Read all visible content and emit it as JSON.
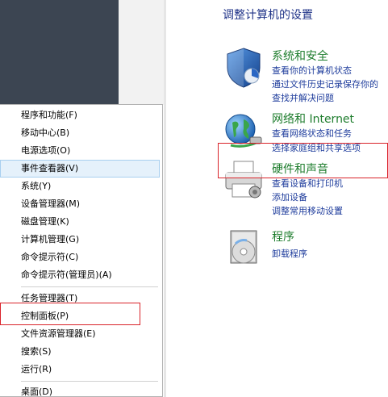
{
  "control_panel": {
    "title": "调整计算机的设置",
    "categories": [
      {
        "icon": "shield-icon",
        "heading": "系统和安全",
        "links": [
          "查看你的计算机状态",
          "通过文件历史记录保存你的",
          "查找并解决问题"
        ]
      },
      {
        "icon": "network-globe-icon",
        "heading": "网络和 Internet",
        "links": [
          "查看网络状态和任务",
          "选择家庭组和共享选项"
        ]
      },
      {
        "icon": "printer-icon",
        "heading": "硬件和声音",
        "links": [
          "查看设备和打印机",
          "添加设备",
          "调整常用移动设置"
        ]
      },
      {
        "icon": "programs-disc-icon",
        "heading": "程序",
        "links": [
          "卸载程序"
        ]
      }
    ]
  },
  "context_menu": {
    "items": [
      "程序和功能(F)",
      "移动中心(B)",
      "电源选项(O)",
      "事件查看器(V)",
      "系统(Y)",
      "设备管理器(M)",
      "磁盘管理(K)",
      "计算机管理(G)",
      "命令提示符(C)",
      "命令提示符(管理员)(A)",
      "任务管理器(T)",
      "控制面板(P)",
      "文件资源管理器(E)",
      "搜索(S)",
      "运行(R)",
      "桌面(D)"
    ],
    "hovered_item": "事件查看器(V)"
  },
  "colors": {
    "heading_green": "#1e7d2d",
    "link_blue": "#1e3c9c",
    "highlight_red": "#d9232a",
    "menu_hover": "#e5f1fb"
  }
}
